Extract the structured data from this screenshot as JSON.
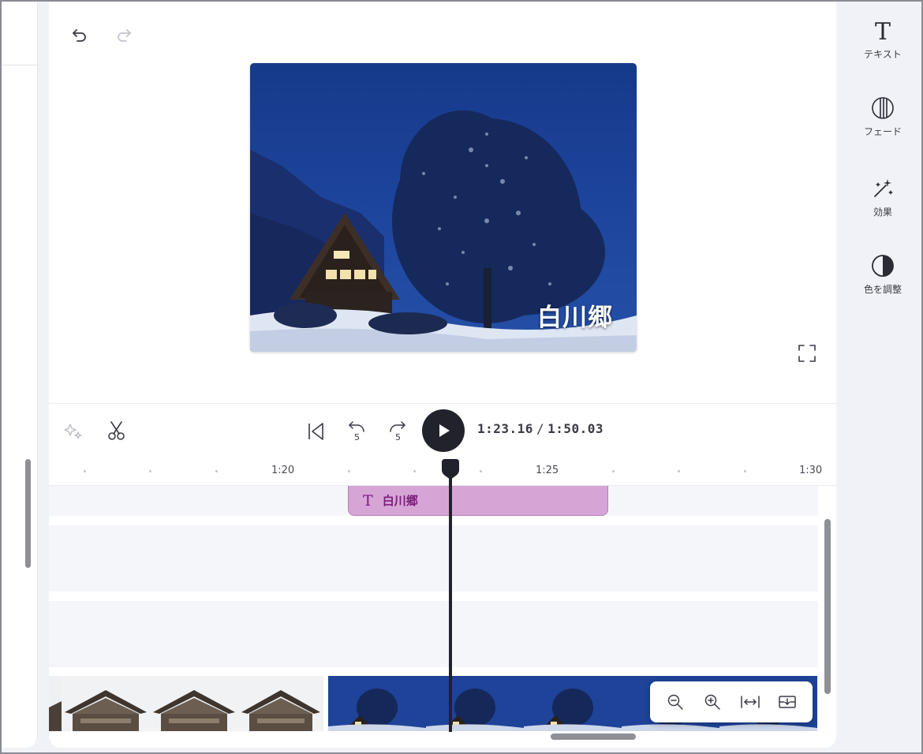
{
  "preview": {
    "caption": "白川郷"
  },
  "player": {
    "current_time": "1:23.16",
    "separator": "/",
    "total_time": "1:50.03"
  },
  "ruler": {
    "labels": [
      "1:20",
      "1:25",
      "1:30"
    ]
  },
  "timeline": {
    "text_clip_icon": "T",
    "text_clip_label": "白川郷",
    "playhead_position": "1:23.16"
  },
  "right_panel": {
    "items": [
      {
        "icon": "text-t-icon",
        "label": "テキスト"
      },
      {
        "icon": "fade-icon",
        "label": "フェード"
      },
      {
        "icon": "magic-wand-icon",
        "label": "効果"
      },
      {
        "icon": "color-contrast-icon",
        "label": "色を調整"
      }
    ]
  },
  "colors": {
    "accent_dark": "#22222c",
    "text_clip": "#d6a5d6",
    "text_clip_ink": "#7a1d7a",
    "night_sky": "#1d3f8c"
  }
}
